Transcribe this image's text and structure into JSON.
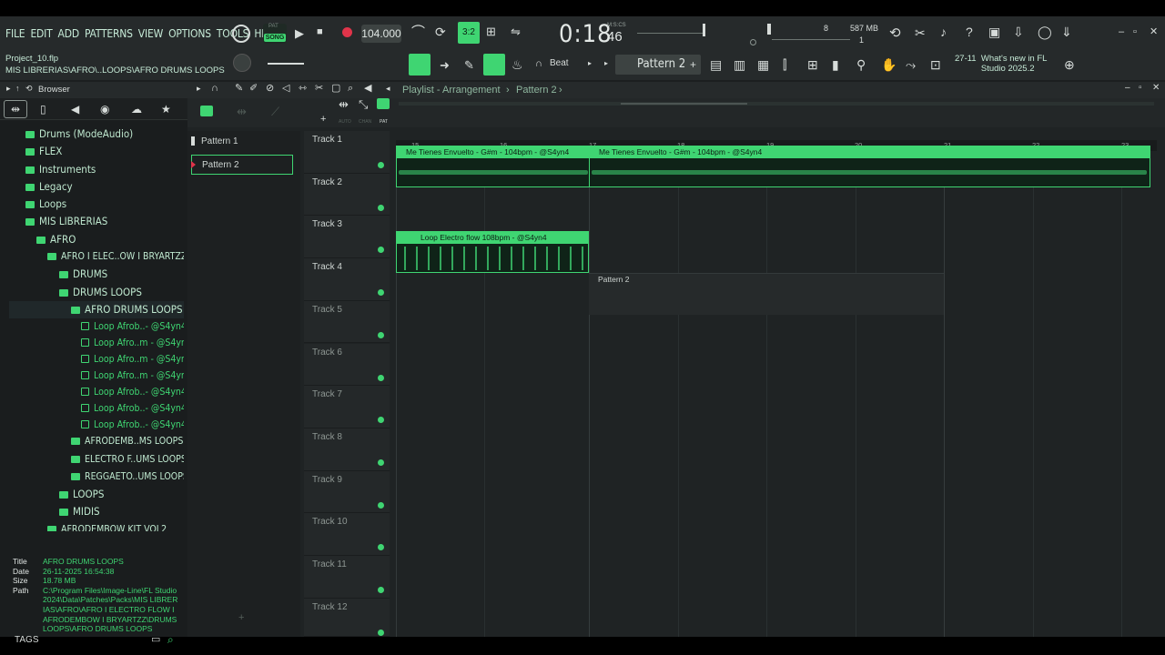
{
  "menu": [
    "FILE",
    "EDIT",
    "ADD",
    "PATTERNS",
    "VIEW",
    "OPTIONS",
    "TOOLS",
    "HELP"
  ],
  "transport": {
    "pat_label": "PAT",
    "song_label": "SONG",
    "tempo": "104.000",
    "time": "0:18",
    "time_sub": "46",
    "time_units": "M:S:CS",
    "step_display": "3:2",
    "cpu": "8",
    "memory": "587 MB",
    "memory2": "1"
  },
  "project": {
    "name": "Project_10.flp",
    "path": "MIS LIBRERIAS\\AFRO\\..LOOPS\\AFRO DRUMS LOOPS"
  },
  "toolbar2": {
    "beat": "Beat",
    "pattern_selector": "Pattern 2",
    "news_date": "27-11",
    "news_title": "What's new in FL Studio 2025.2"
  },
  "browser": {
    "title": "Browser",
    "tree": [
      {
        "label": "Drums (ModeAudio)",
        "level": 0
      },
      {
        "label": "FLEX",
        "level": 0
      },
      {
        "label": "Instruments",
        "level": 0
      },
      {
        "label": "Legacy",
        "level": 0
      },
      {
        "label": "Loops",
        "level": 0
      },
      {
        "label": "MIS LIBRERIAS",
        "level": 0
      },
      {
        "label": "AFRO",
        "level": 1
      },
      {
        "label": "AFRO I ELEC..OW I BRYARTZZ",
        "level": 2
      },
      {
        "label": "DRUMS",
        "level": 3
      },
      {
        "label": "DRUMS LOOPS",
        "level": 3
      },
      {
        "label": "AFRO DRUMS LOOPS",
        "level": 4
      }
    ],
    "files": [
      "Loop Afrob..- @S4yn4",
      "Loop Afro..m - @S4yn4",
      "Loop Afro..m - @S4yn4",
      "Loop Afro..m - @S4yn4",
      "Loop Afrob..- @S4yn4",
      "Loop Afrob..- @S4yn4",
      "Loop Afrob..- @S4yn4"
    ],
    "tree2": [
      {
        "label": "AFRODEMB..MS LOOPS",
        "level": 4
      },
      {
        "label": "ELECTRO F..UMS LOOPS",
        "level": 4
      },
      {
        "label": "REGGAETO..UMS LOOPS",
        "level": 4
      },
      {
        "label": "LOOPS",
        "level": 3
      },
      {
        "label": "MIDIS",
        "level": 3
      },
      {
        "label": "AFRODEMBOW KIT VOL2",
        "level": 2
      }
    ],
    "meta": {
      "title_k": "Title",
      "title": "AFRO DRUMS LOOPS",
      "date_k": "Date",
      "date": "26-11-2025 16:54:38",
      "size_k": "Size",
      "size": "18.78 MB",
      "path_k": "Path",
      "path": "C:\\Program Files\\Image-Line\\FL Studio 2024\\Data\\Patches\\Packs\\MIS LIBRERIAS\\AFRO\\AFRO I ELECTRO FLOW I AFRODEMBOW I BRYARTZZ\\DRUMS LOOPS\\AFRO DRUMS LOOPS"
    },
    "tags": "TAGS"
  },
  "playlist": {
    "title": "Playlist - Arrangement",
    "current": "Pattern 2",
    "header_labels": [
      "AUTO",
      "CHAN",
      "PAT"
    ],
    "patterns": [
      "Pattern 1",
      "Pattern 2"
    ],
    "ruler": [
      "15",
      "16",
      "17",
      "18",
      "19",
      "20",
      "21",
      "22",
      "23"
    ],
    "tracks": [
      "Track 1",
      "Track 2",
      "Track 3",
      "Track 4",
      "Track 5",
      "Track 6",
      "Track 7",
      "Track 8",
      "Track 9",
      "Track 10",
      "Track 11",
      "Track 12"
    ],
    "clips": {
      "audio1a": "Me Tienes Envuelto - G#m - 104bpm - @S4yn4",
      "audio1b": "Me Tienes Envuelto - G#m - 104bpm - @S4yn4",
      "audio3": "Loop Electro flow 108bpm - @S4yn4",
      "pattern4": "Pattern 2"
    }
  },
  "colors": {
    "accent": "#3fd572",
    "bg": "#1c1f20",
    "panel": "#262a2b"
  }
}
